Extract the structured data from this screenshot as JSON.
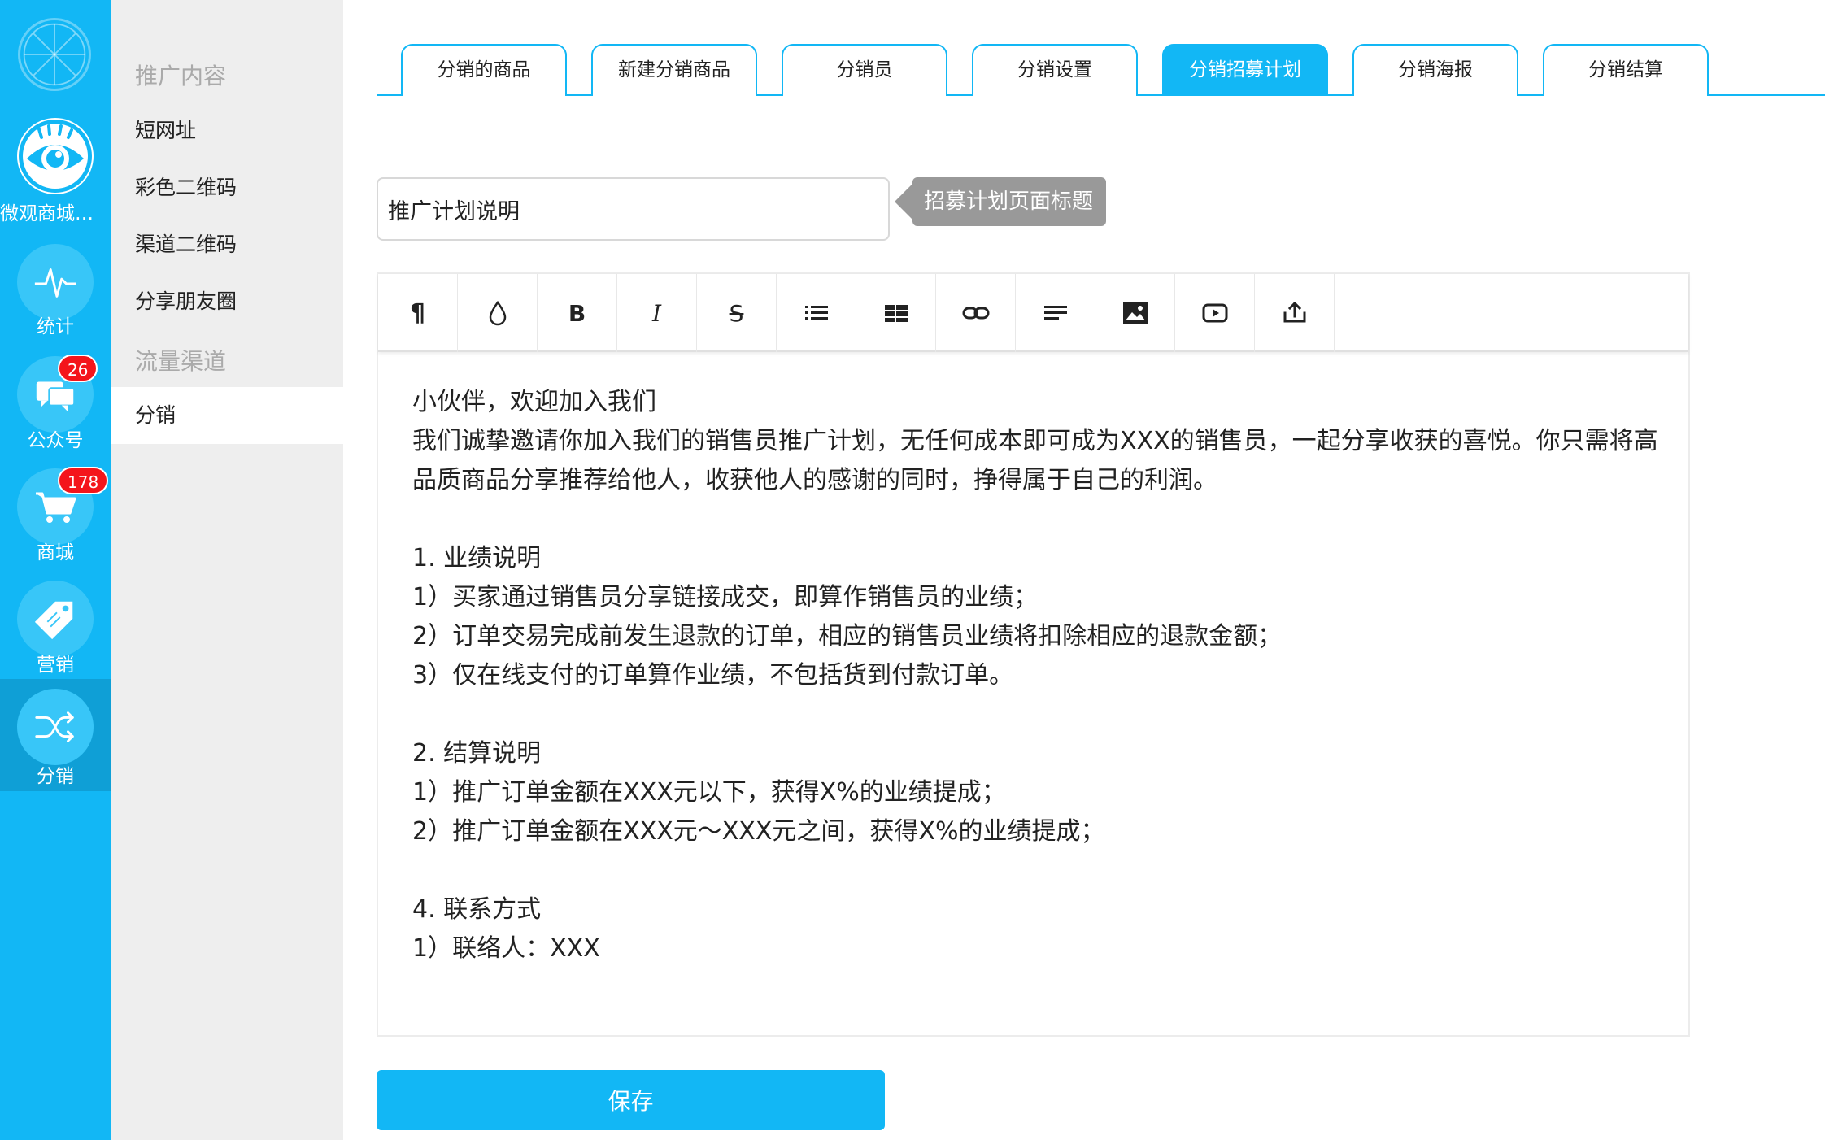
{
  "rail": {
    "items": [
      {
        "label": "微观商城测..."
      },
      {
        "label": "统计"
      },
      {
        "label": "公众号",
        "badge": "26"
      },
      {
        "label": "商城",
        "badge": "178"
      },
      {
        "label": "营销"
      },
      {
        "label": "分销"
      }
    ]
  },
  "subnav": {
    "group1": "推广内容",
    "items1": [
      {
        "label": "短网址"
      },
      {
        "label": "彩色二维码"
      },
      {
        "label": "渠道二维码"
      },
      {
        "label": "分享朋友圈"
      }
    ],
    "group2": "流量渠道",
    "items2": [
      {
        "label": "分销"
      }
    ]
  },
  "tabs": [
    {
      "label": "分销的商品"
    },
    {
      "label": "新建分销商品"
    },
    {
      "label": "分销员"
    },
    {
      "label": "分销设置"
    },
    {
      "label": "分销招募计划"
    },
    {
      "label": "分销海报"
    },
    {
      "label": "分销结算"
    }
  ],
  "form": {
    "title_value": "推广计划说明",
    "title_hint": "招募计划页面标题",
    "save_label": "保存"
  },
  "toolbar": {
    "icons": [
      "paragraph-icon",
      "color-drop-icon",
      "bold-icon",
      "italic-icon",
      "strikethrough-icon",
      "bullet-list-icon",
      "table-icon",
      "link-icon",
      "align-icon",
      "image-icon",
      "video-icon",
      "upload-icon"
    ],
    "paragraph": "¶",
    "bold": "B",
    "italic": "I",
    "strike": "S"
  },
  "content": {
    "lines": [
      "小伙伴，欢迎加入我们",
      "我们诚挚邀请你加入我们的销售员推广计划，无任何成本即可成为XXX的销售员，一起分享收获的喜悦。你只需将高品质商品分享推荐给他人，收获他人的感谢的同时，挣得属于自己的利润。",
      "",
      "1. 业绩说明",
      "1）买家通过销售员分享链接成交，即算作销售员的业绩；",
      "2）订单交易完成前发生退款的订单，相应的销售员业绩将扣除相应的退款金额；",
      "3）仅在线支付的订单算作业绩，不包括货到付款订单。",
      "",
      "2. 结算说明",
      "1）推广订单金额在XXX元以下，获得X%的业绩提成；",
      "2）推广订单金额在XXX元～XXX元之间，获得X%的业绩提成；",
      "",
      "4. 联系方式",
      "1）联络人：XXX"
    ]
  },
  "colors": {
    "accent": "#12b7f5",
    "badge": "#f4151b"
  }
}
